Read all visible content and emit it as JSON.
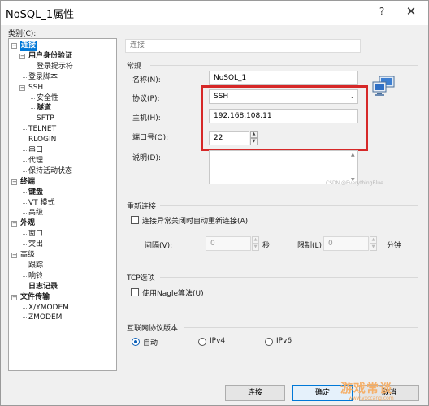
{
  "window": {
    "title": "NoSQL_1属性",
    "help": "?",
    "close": "✕"
  },
  "category_label": "类别(C):",
  "tree": [
    {
      "label": "连接",
      "bold": true,
      "selected": true,
      "toggle": "−"
    },
    {
      "label": "用户身份验证",
      "bold": true,
      "toggle": "−"
    },
    {
      "label": "登录提示符"
    },
    {
      "label": "登录脚本"
    },
    {
      "label": "SSH",
      "toggle": "−"
    },
    {
      "label": "安全性"
    },
    {
      "label": "隧道",
      "bold": true
    },
    {
      "label": "SFTP"
    },
    {
      "label": "TELNET"
    },
    {
      "label": "RLOGIN"
    },
    {
      "label": "串口"
    },
    {
      "label": "代理"
    },
    {
      "label": "保持活动状态"
    },
    {
      "label": "终端",
      "bold": true,
      "toggle": "−"
    },
    {
      "label": "键盘",
      "bold": true
    },
    {
      "label": "VT 模式"
    },
    {
      "label": "高级"
    },
    {
      "label": "外观",
      "bold": true,
      "toggle": "−"
    },
    {
      "label": "窗口"
    },
    {
      "label": "突出"
    },
    {
      "label": "高级",
      "toggle": "−"
    },
    {
      "label": "跟踪"
    },
    {
      "label": "响铃"
    },
    {
      "label": "日志记录",
      "bold": true
    },
    {
      "label": "文件传输",
      "bold": true,
      "toggle": "−"
    },
    {
      "label": "X/YMODEM"
    },
    {
      "label": "ZMODEM"
    }
  ],
  "section_header": "连接",
  "general": {
    "title": "常规",
    "name_label": "名称(N):",
    "name_value": "NoSQL_1",
    "protocol_label": "协议(P):",
    "protocol_value": "SSH",
    "host_label": "主机(H):",
    "host_value": "192.168.108.11",
    "port_label": "端口号(O):",
    "port_value": "22",
    "desc_label": "说明(D):",
    "desc_value": ""
  },
  "reconnect": {
    "title": "重新连接",
    "checkbox_label": "连接异常关闭时自动重新连接(A)",
    "interval_label": "间隔(V):",
    "interval_value": "0",
    "interval_unit": "秒",
    "limit_label": "限制(L):",
    "limit_value": "0",
    "limit_unit": "分钟"
  },
  "tcp": {
    "title": "TCP选项",
    "checkbox_label": "使用Nagle算法(U)"
  },
  "ipver": {
    "title": "互联网协议版本",
    "options": [
      "自动",
      "IPv4",
      "IPv6"
    ],
    "selected": "自动"
  },
  "buttons": {
    "connect": "连接",
    "ok": "确定",
    "cancel": "取消"
  },
  "watermark": {
    "small": "CSDN @EverythingBlue",
    "big": "游戏常谈",
    "url": "www.yxccang.com"
  },
  "colors": {
    "highlight_box": "#d62828",
    "selection": "#0078d7"
  }
}
